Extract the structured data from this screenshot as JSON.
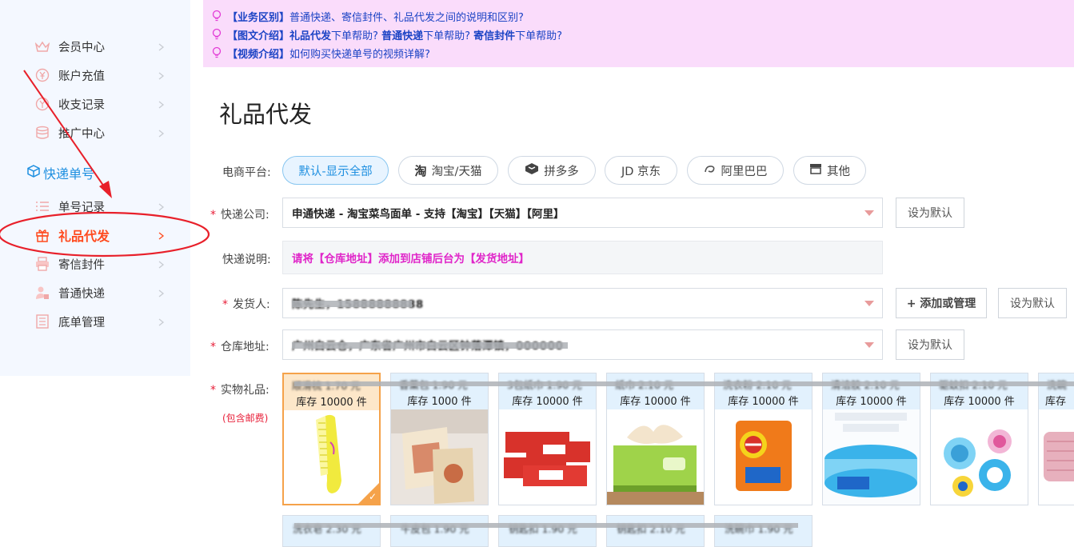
{
  "sidebar": {
    "items_top": [
      {
        "label": "会员中心",
        "icon": "crown-icon"
      },
      {
        "label": "账户充值",
        "icon": "yen-icon"
      },
      {
        "label": "收支记录",
        "icon": "yen-circle-icon"
      },
      {
        "label": "推广中心",
        "icon": "database-icon"
      }
    ],
    "section_title": "快递单号",
    "items_bottom": [
      {
        "label": "单号记录",
        "icon": "list-icon"
      },
      {
        "label": "礼品代发",
        "icon": "gift-icon",
        "active": true
      },
      {
        "label": "寄信封件",
        "icon": "printer-icon"
      },
      {
        "label": "普通快递",
        "icon": "courier-icon"
      },
      {
        "label": "底单管理",
        "icon": "document-icon"
      }
    ]
  },
  "notice": {
    "line1": {
      "tag": "【业务区别】",
      "text": "普通快递、寄信封件、礼品代发之间的说明和区别?"
    },
    "line2": {
      "tag": "【图文介绍】",
      "a": "礼品代发",
      "a_suffix": "下单帮助?",
      "b": "普通快递",
      "b_suffix": "下单帮助?",
      "c": "寄信封件",
      "c_suffix": "下单帮助?"
    },
    "line3": {
      "tag": "【视频介绍】",
      "text": "如何购买快递单号的视频详解?"
    }
  },
  "page_title": "礼品代发",
  "form": {
    "platform_label": "电商平台:",
    "platforms": [
      "默认-显示全部",
      "淘宝/天猫",
      "拼多多",
      "JD 京东",
      "阿里巴巴",
      "其他"
    ],
    "courier_label": "快递公司:",
    "courier_value": "申通快递 - 淘宝菜鸟面单 - 支持【淘宝】【天猫】【阿里】",
    "set_default": "设为默认",
    "note_label": "快递说明:",
    "note_value": "请将【仓库地址】添加到店铺后台为【发货地址】",
    "sender_label": "发货人:",
    "sender_value": "陈先生，15888888888",
    "add_manage": "+ 添加或管理",
    "warehouse_label": "仓库地址:",
    "warehouse_value": "广州白云仓，广东省广州市白云区钟落潭镇，000000",
    "gift_label": "实物礼品:",
    "gift_sub": "(包含邮费)"
  },
  "gifts": [
    {
      "name": "顺滑梳 1.70 元",
      "stock": "库存 10000 件",
      "selected": true
    },
    {
      "name": "香薰包 1.90 元",
      "stock": "库存 1000 件"
    },
    {
      "name": "3包纸巾 1.90 元",
      "stock": "库存 10000 件"
    },
    {
      "name": "纸巾 2.10 元",
      "stock": "库存 10000 件"
    },
    {
      "name": "洗衣粉 2.10 元",
      "stock": "库存 10000 件"
    },
    {
      "name": "清洁胶 2.10 元",
      "stock": "库存 10000 件"
    },
    {
      "name": "驱蚊扣 2.10 元",
      "stock": "库存 10000 件"
    },
    {
      "name": "洗碗",
      "stock": "库存"
    }
  ],
  "gifts_row2": [
    "洗衣皂 2.30 元",
    "牛皮包 1.90 元",
    "钥匙扣 1.90 元",
    "钥匙扣 2.10 元",
    "洗碗巾 1.90 元"
  ],
  "colors": {
    "accent": "#1e8fe0",
    "active": "#ff4a1e",
    "notice_bg": "#fadcfb",
    "highlight": "#e026c9"
  }
}
